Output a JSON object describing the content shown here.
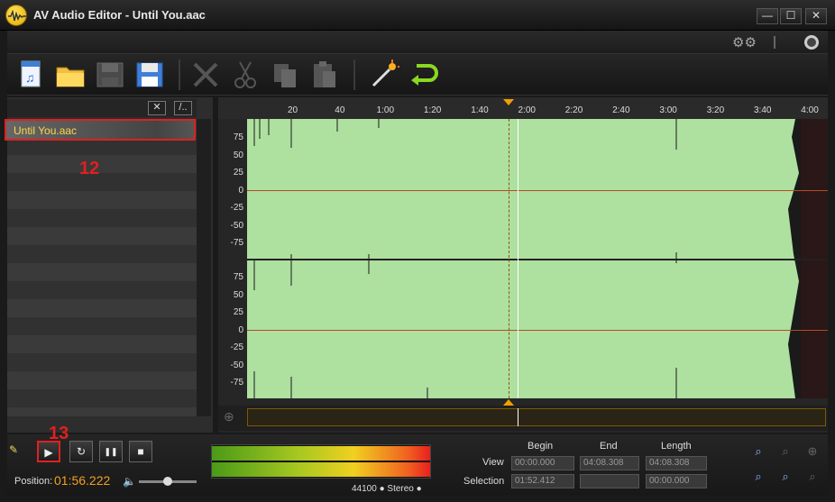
{
  "window": {
    "title": "AV Audio Editor - Until You.aac",
    "minimize": "—",
    "maximize": "☐",
    "close": "✕"
  },
  "left_panel": {
    "close_label": "✕",
    "more_label": "/..",
    "files": [
      "Until You.aac"
    ]
  },
  "annotations": {
    "list": "12",
    "play": "13"
  },
  "ruler": {
    "ticks": [
      "20",
      "40",
      "1:00",
      "1:20",
      "1:40",
      "2:00",
      "2:20",
      "2:40",
      "3:00",
      "3:20",
      "3:40",
      "4:00"
    ]
  },
  "scale": {
    "top": [
      "75",
      "50",
      "25",
      "0",
      "-25",
      "-50",
      "-75"
    ],
    "bottom": [
      "75",
      "50",
      "25",
      "0",
      "-25",
      "-50",
      "-75"
    ]
  },
  "transport": {
    "play": "▶",
    "loop": "↻",
    "pause": "❚❚",
    "stop": "■",
    "position_label": "Position:",
    "position_value": "01:56.222"
  },
  "meter": {
    "info": "44100 ● Stereo ●"
  },
  "time_grid": {
    "headers": {
      "begin": "Begin",
      "end": "End",
      "length": "Length"
    },
    "view": {
      "label": "View",
      "begin": "00:00.000",
      "end": "04:08.308",
      "length": "04:08.308"
    },
    "selection": {
      "label": "Selection",
      "begin": "01:52.412",
      "end": "",
      "length": "00:00.000"
    }
  },
  "colors": {
    "wave": "#aee0a0",
    "accent": "#f0a020",
    "highlight": "#e02020"
  }
}
